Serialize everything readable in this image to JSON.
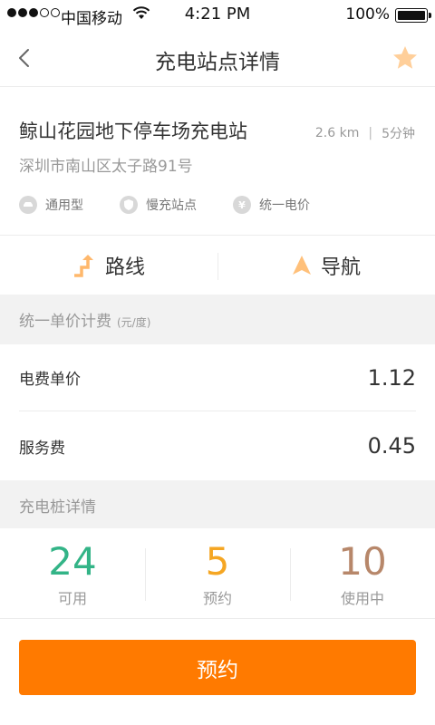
{
  "status_bar": {
    "carrier": "中国移动",
    "time": "4:21 PM",
    "battery": "100%"
  },
  "nav": {
    "title": "充电站点详情",
    "back_icon": "chevron-left-icon",
    "favorite_icon": "star-icon",
    "accent_color": "#ffcf9a"
  },
  "station": {
    "name": "鲸山花园地下停车场充电站",
    "distance": "2.6 km",
    "time": "5分钟",
    "address": "深圳市南山区太子路91号",
    "tags": [
      {
        "icon": "car-icon",
        "label": "通用型"
      },
      {
        "icon": "shield-icon",
        "label": "慢充站点"
      },
      {
        "icon": "yen-icon",
        "label": "统一电价"
      }
    ]
  },
  "actions": {
    "route_label": "路线",
    "navigate_label": "导航"
  },
  "pricing": {
    "header": "统一单价计费",
    "unit": "(元/度)",
    "electricity_label": "电费单价",
    "electricity_value": "1.12",
    "service_label": "服务费",
    "service_value": "0.45"
  },
  "piles": {
    "header": "充电桩详情",
    "stats": [
      {
        "value": "24",
        "label": "可用",
        "color": "#33b487"
      },
      {
        "value": "5",
        "label": "预约",
        "color": "#f5a623"
      },
      {
        "value": "10",
        "label": "使用中",
        "color": "#b7876a"
      }
    ]
  },
  "reserve_button": {
    "label": "预约",
    "color": "#ff7a00"
  }
}
